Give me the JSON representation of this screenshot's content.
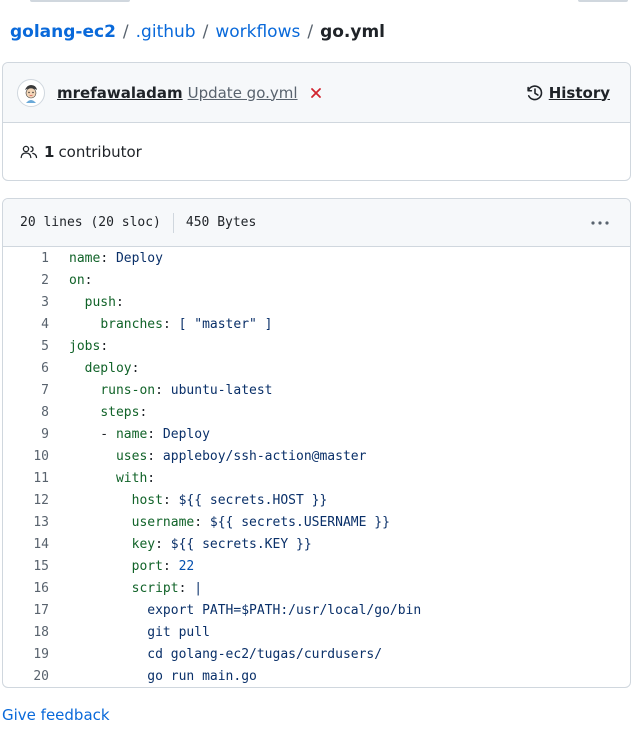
{
  "breadcrumb": {
    "repo": "golang-ec2",
    "folder1": ".github",
    "folder2": "workflows",
    "file": "go.yml",
    "separator": "/"
  },
  "commit": {
    "author": "mrefawaladam",
    "message": "Update go.yml",
    "status": "failure",
    "status_color": "#d1242f",
    "history_label": "History"
  },
  "contributors": {
    "count": "1",
    "label": "contributor"
  },
  "file": {
    "lines_info": "20 lines (20 sloc)",
    "size": "450 Bytes",
    "code": [
      {
        "num": "1",
        "indent": "",
        "key": "name",
        "colon": ":",
        "value": " Deploy"
      },
      {
        "num": "2",
        "indent": "",
        "key": "on",
        "colon": ":",
        "value": ""
      },
      {
        "num": "3",
        "indent": "  ",
        "key": "push",
        "colon": ":",
        "value": ""
      },
      {
        "num": "4",
        "indent": "    ",
        "key": "branches",
        "colon": ":",
        "value": " [ \"master\" ]"
      },
      {
        "num": "5",
        "indent": "",
        "key": "jobs",
        "colon": ":",
        "value": ""
      },
      {
        "num": "6",
        "indent": "  ",
        "key": "deploy",
        "colon": ":",
        "value": ""
      },
      {
        "num": "7",
        "indent": "    ",
        "key": "runs-on",
        "colon": ":",
        "value": " ubuntu-latest"
      },
      {
        "num": "8",
        "indent": "    ",
        "key": "steps",
        "colon": ":",
        "value": ""
      },
      {
        "num": "9",
        "indent": "    - ",
        "key": "name",
        "colon": ":",
        "value": " Deploy"
      },
      {
        "num": "10",
        "indent": "      ",
        "key": "uses",
        "colon": ":",
        "value": " appleboy/ssh-action@master"
      },
      {
        "num": "11",
        "indent": "      ",
        "key": "with",
        "colon": ":",
        "value": ""
      },
      {
        "num": "12",
        "indent": "        ",
        "key": "host",
        "colon": ":",
        "value": " ${{ secrets.HOST }}"
      },
      {
        "num": "13",
        "indent": "        ",
        "key": "username",
        "colon": ":",
        "value": " ${{ secrets.USERNAME }}"
      },
      {
        "num": "14",
        "indent": "        ",
        "key": "key",
        "colon": ":",
        "value": " ${{ secrets.KEY }}"
      },
      {
        "num": "15",
        "indent": "        ",
        "key": "port",
        "colon": ":",
        "value": " 22"
      },
      {
        "num": "16",
        "indent": "        ",
        "key": "script",
        "colon": ":",
        "value": " |"
      },
      {
        "num": "17",
        "indent": "          ",
        "key": "",
        "colon": "",
        "value": "export PATH=$PATH:/usr/local/go/bin"
      },
      {
        "num": "18",
        "indent": "          ",
        "key": "",
        "colon": "",
        "value": "git pull"
      },
      {
        "num": "19",
        "indent": "          ",
        "key": "",
        "colon": "",
        "value": "cd golang-ec2/tugas/curdusers/"
      },
      {
        "num": "20",
        "indent": "          ",
        "key": "",
        "colon": "",
        "value": "go run main.go"
      }
    ]
  },
  "footer": {
    "feedback_label": "Give feedback"
  }
}
